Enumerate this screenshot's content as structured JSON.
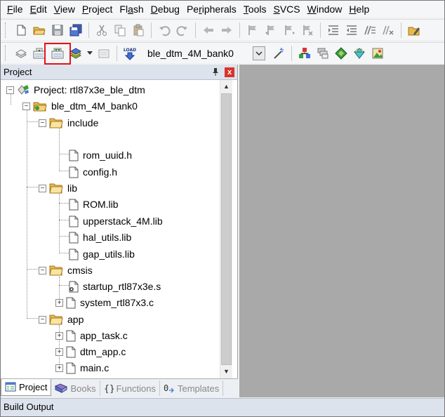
{
  "menu": {
    "file": {
      "u": "F",
      "rest": "ile"
    },
    "edit": {
      "u": "E",
      "rest": "dit"
    },
    "view": {
      "u": "V",
      "rest": "iew"
    },
    "project": {
      "u": "P",
      "rest": "roject"
    },
    "flash": {
      "pre": "Fl",
      "u": "a",
      "rest": "sh"
    },
    "debug": {
      "u": "D",
      "rest": "ebug"
    },
    "peripherals": {
      "pre": "Pe",
      "u": "r",
      "rest": "ipherals"
    },
    "tools": {
      "u": "T",
      "rest": "ools"
    },
    "svcs": {
      "u": "S",
      "rest": "VCS"
    },
    "window": {
      "u": "W",
      "rest": "indow"
    },
    "help": {
      "u": "H",
      "rest": "elp"
    }
  },
  "toolbar2": {
    "load_label": "LOAD",
    "target_value": "ble_dtm_4M_bank0"
  },
  "panel": {
    "title": "Project",
    "pin": " p",
    "close": "x"
  },
  "tree": {
    "root": "Project: rtl87x3e_ble_dtm",
    "target": "ble_dtm_4M_bank0",
    "groups": {
      "include": "include",
      "lib": "lib",
      "cmsis": "cmsis",
      "app": "app"
    },
    "files": {
      "rom_uuid": "rom_uuid.h",
      "config": "config.h",
      "rom_lib": "ROM.lib",
      "upperstack": "upperstack_4M.lib",
      "hal_utils": "hal_utils.lib",
      "gap_utils": "gap_utils.lib",
      "startup": "startup_rtl87x3e.s",
      "system": "system_rtl87x3.c",
      "app_task": "app_task.c",
      "dtm_app": "dtm_app.c",
      "main": "main.c"
    }
  },
  "tabs": {
    "project": "Project",
    "books": "Books",
    "functions": "Functions",
    "templates": "Templates"
  },
  "build_output": "Build Output",
  "colors": {
    "highlight": "#e0141e",
    "editor_bg": "#a9a9a9",
    "panel_header": "#dde3ec"
  }
}
